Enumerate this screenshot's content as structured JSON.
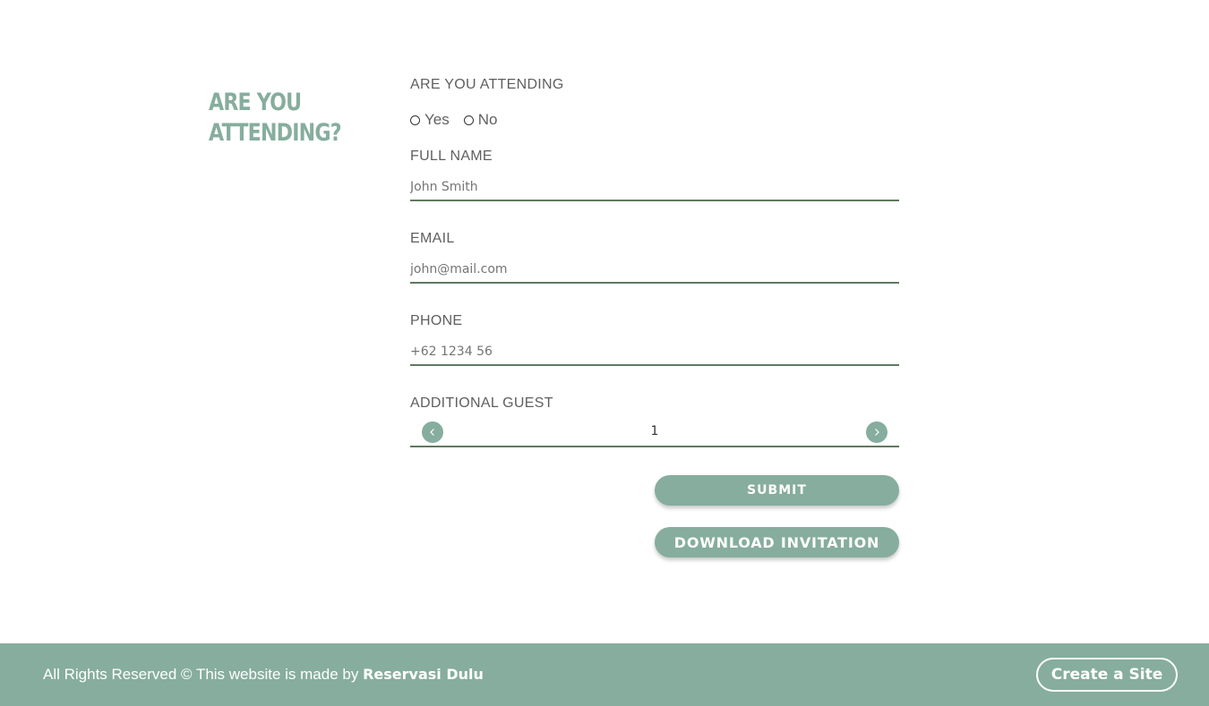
{
  "section": {
    "heading_line1": "ARE YOU",
    "heading_line2": "ATTENDING?"
  },
  "form": {
    "attending": {
      "label": "ARE YOU ATTENDING",
      "options": [
        "Yes",
        "No"
      ]
    },
    "full_name": {
      "label": "FULL NAME",
      "placeholder": "John Smith"
    },
    "email": {
      "label": "EMAIL",
      "placeholder": "john@mail.com"
    },
    "phone": {
      "label": "PHONE",
      "placeholder": "+62 1234 56"
    },
    "additional_guest": {
      "label": "ADDITIONAL GUEST",
      "value": "1"
    },
    "submit_label": "SUBMIT",
    "download_label": "DOWNLOAD INVITATION"
  },
  "footer": {
    "copyright_text": "All Rights Reserved © This website is made by",
    "brand": "Reservasi Dulu",
    "create_site_label": "Create a Site"
  },
  "colors": {
    "accent": "#86ad9e",
    "underline": "#5e7a5e",
    "text": "#5f5f5f"
  }
}
